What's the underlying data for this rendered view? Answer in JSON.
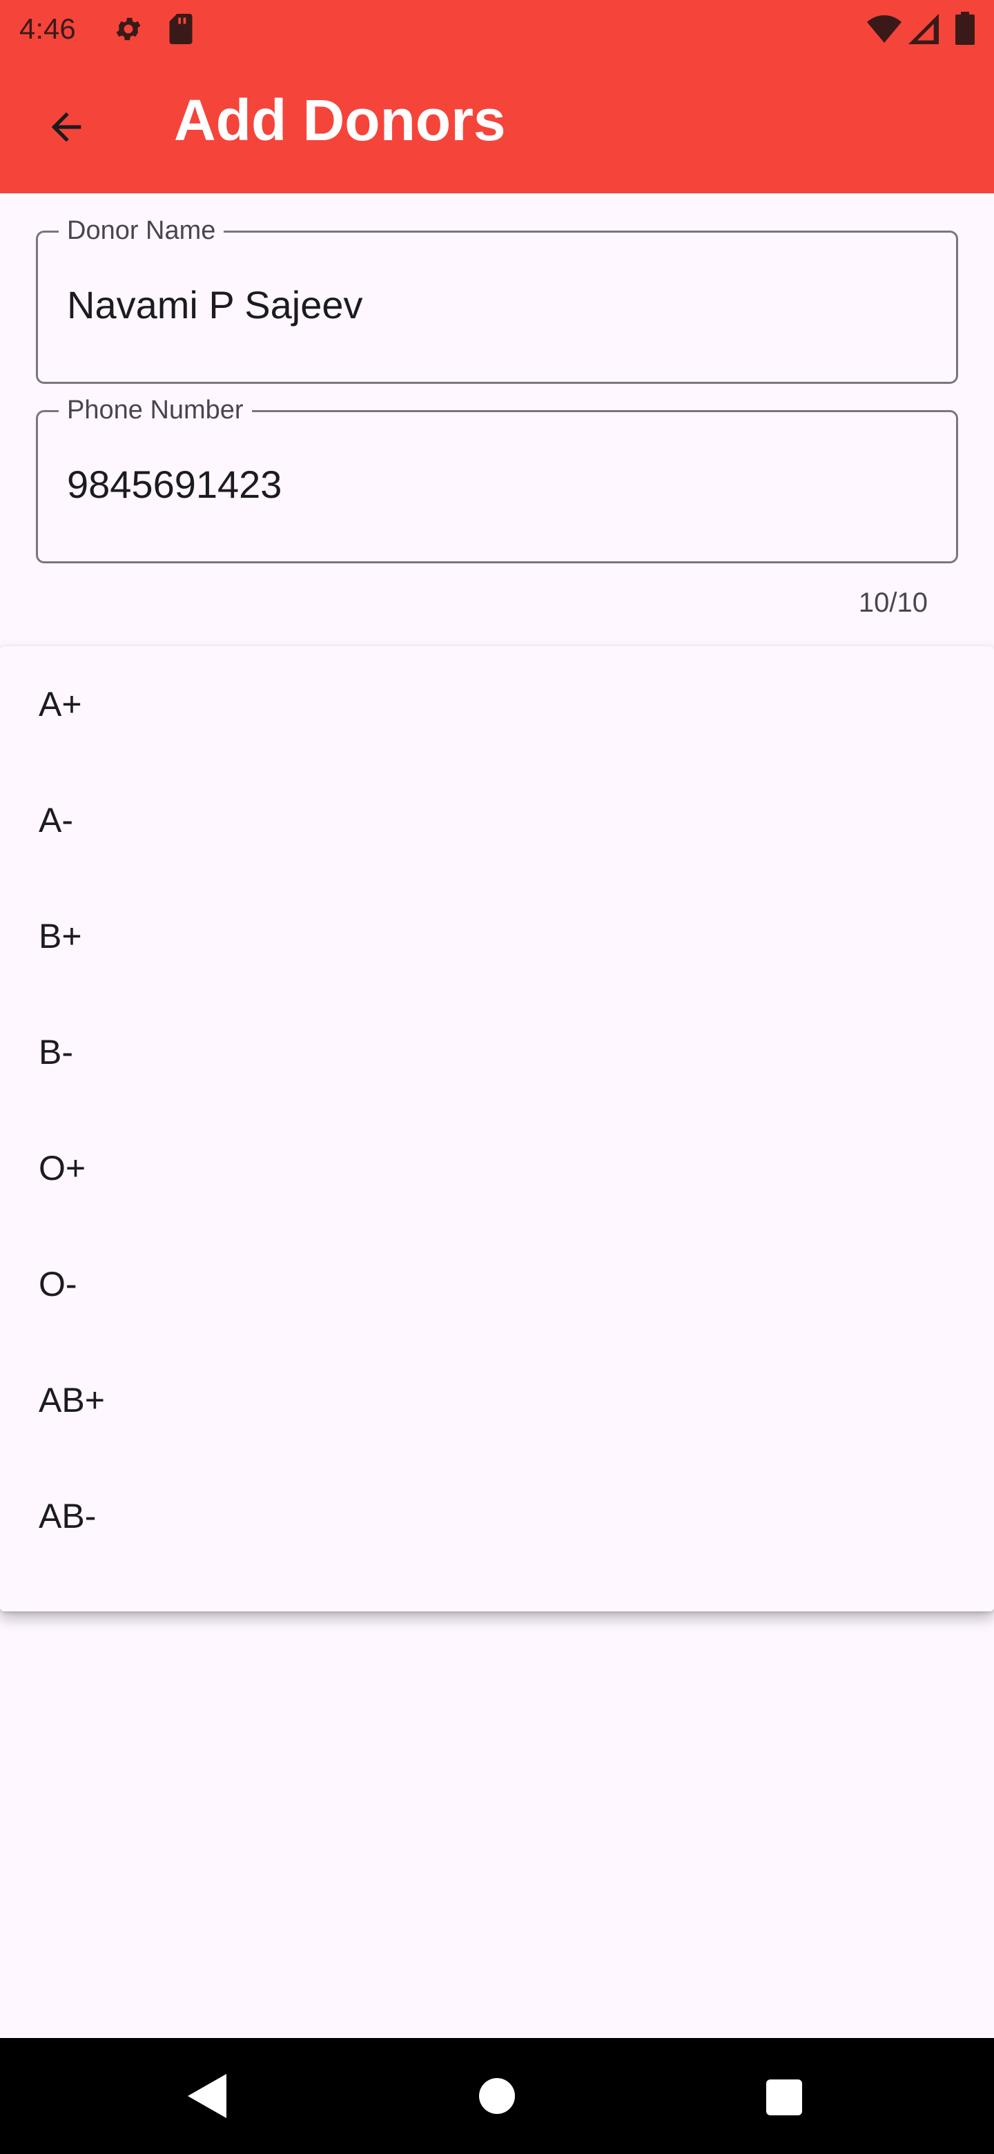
{
  "status_bar": {
    "time": "4:46",
    "icons": [
      "gear-icon",
      "sd-card-icon",
      "wifi-icon",
      "signal-icon",
      "battery-icon"
    ]
  },
  "app_bar": {
    "title": "Add Donors",
    "back_icon": "arrow-back-icon",
    "color": "#F5443A"
  },
  "form": {
    "donor_name": {
      "label": "Donor Name",
      "value": "Navami P Sajeev"
    },
    "phone_number": {
      "label": "Phone Number",
      "value": "9845691423",
      "counter": "10/10"
    }
  },
  "blood_group_dropdown": {
    "options": [
      "A+",
      "A-",
      "B+",
      "B-",
      "O+",
      "O-",
      "AB+",
      "AB-"
    ]
  },
  "nav_bar": {
    "icons": [
      "back-triangle-icon",
      "home-circle-icon",
      "recents-square-icon"
    ]
  }
}
